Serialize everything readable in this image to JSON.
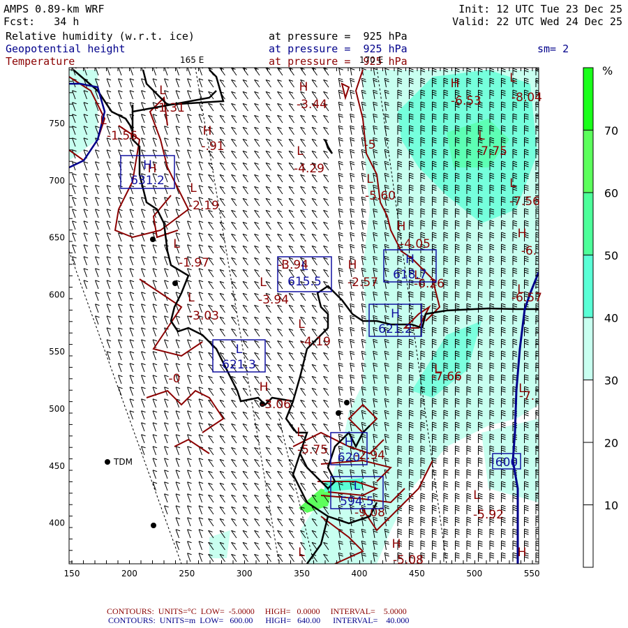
{
  "header": {
    "model": "AMPS 0.89-km WRF",
    "fcst": "Fcst:   34 h",
    "init": "Init: 12 UTC Tue 23 Dec 25",
    "valid": "Valid: 22 UTC Wed 24 Dec 25",
    "fields": [
      {
        "name": "Relative humidity (w.r.t. ice)",
        "level": "at pressure =  925 hPa"
      },
      {
        "name": "Geopotential height",
        "level": "at pressure =  925 hPa"
      },
      {
        "name": "Temperature",
        "level": "at pressure =  925 hPa"
      }
    ],
    "smoothing": "sm= 2",
    "meridians": [
      "165 E",
      "170 E"
    ]
  },
  "axes": {
    "x_ticks": [
      "150",
      "200",
      "250",
      "300",
      "350",
      "400",
      "450",
      "500",
      "550"
    ],
    "y_ticks": [
      "750",
      "700",
      "650",
      "600",
      "550",
      "500",
      "450",
      "400"
    ]
  },
  "colorbar": {
    "unit": "%",
    "labels": [
      "70",
      "60",
      "50",
      "40",
      "30",
      "20",
      "10"
    ],
    "colors": [
      "#1aff1a",
      "#5cff5c",
      "#4dff9a",
      "#5affd6",
      "#c8fff0",
      "#ffffff",
      "#ffffff",
      "#ffffff"
    ]
  },
  "station": "TDM",
  "temp_labels": [
    [
      "L",
      "-1.31"
    ],
    [
      "H",
      "-3.44"
    ],
    [
      "H",
      "-6.53"
    ],
    [
      "L",
      "-8.04"
    ],
    [
      "L",
      "-1.56"
    ],
    [
      "H",
      "-.91"
    ],
    [
      "L",
      "-4.29"
    ],
    [
      "",
      "-5"
    ],
    [
      "L",
      "-7.75"
    ],
    [
      "L",
      "-5.60"
    ],
    [
      "L",
      "-2.19"
    ],
    [
      "L",
      "-7.56"
    ],
    [
      "H",
      "-4.05"
    ],
    [
      "L",
      "-1.97"
    ],
    [
      "H",
      "-6."
    ],
    [
      "L",
      "-3.94"
    ],
    [
      "H",
      "-2.57"
    ],
    [
      "L",
      "-6.57"
    ],
    [
      "L",
      "-3.03"
    ],
    [
      "L",
      "-4.19"
    ],
    [
      "",
      "-0"
    ],
    [
      "L",
      "-7.66"
    ],
    [
      "H",
      "-3.06"
    ],
    [
      "L",
      "-7."
    ],
    [
      "L",
      "-5.75"
    ],
    [
      "",
      "-2.94"
    ],
    [
      "",
      "-9.08"
    ],
    [
      "L",
      "-5.92"
    ],
    [
      "H",
      "-5.08"
    ],
    [
      "L",
      ""
    ],
    [
      "H",
      ""
    ],
    [
      "L",
      "-3.94"
    ],
    [
      "H",
      ""
    ],
    [
      "L",
      "-6.26"
    ]
  ],
  "height_labels": [
    [
      "H",
      "631.2"
    ],
    [
      "L",
      "615.5"
    ],
    [
      "H",
      "618.7"
    ],
    [
      "H",
      "621.2"
    ],
    [
      "L",
      "621.3"
    ],
    [
      "H",
      "620"
    ],
    [
      "L",
      "594.5"
    ],
    [
      "",
      "600"
    ]
  ],
  "footer": {
    "temp": {
      "label": "CONTOURS:",
      "units": "UNITS=°C",
      "low": "LOW=  -5.0000",
      "high": "HIGH=   0.0000",
      "interval": "INTERVAL=    5.0000"
    },
    "height": {
      "label": "CONTOURS:",
      "units": "UNITS=m",
      "low": "LOW=   600.00",
      "high": "HIGH=   640.00",
      "interval": "INTERVAL=    40.000"
    }
  }
}
